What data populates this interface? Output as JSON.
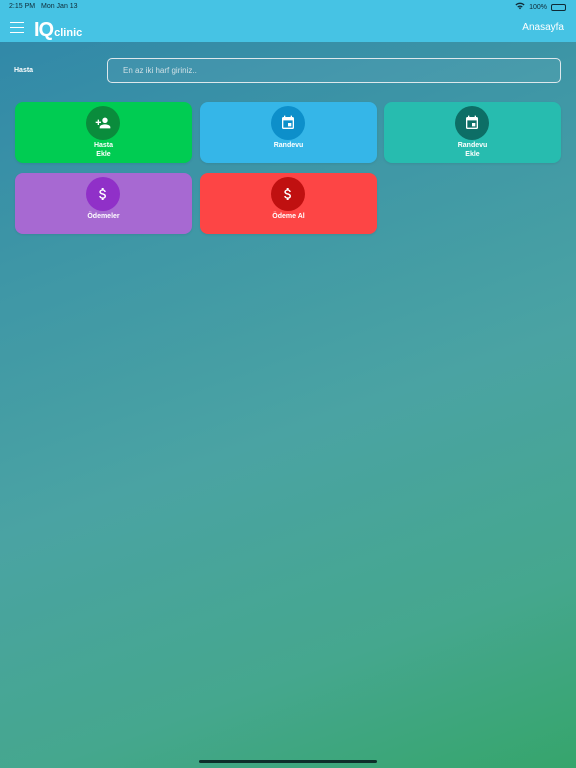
{
  "status_bar": {
    "time": "2:15 PM",
    "date": "Mon Jan 13",
    "battery": "100%",
    "battery_level": 1.0
  },
  "navbar": {
    "logo_iq": "IQ",
    "logo_text": "clinic",
    "title": "Anasayfa"
  },
  "search": {
    "label": "Hasta",
    "placeholder": "En az iki harf giriniz.."
  },
  "tiles": [
    {
      "label_line1": "Hasta",
      "label_line2": "Ekle",
      "icon": "add-user-icon",
      "color": "#00cc52",
      "icon_bg": "#0a8c3c"
    },
    {
      "label_line1": "Randevu",
      "label_line2": "",
      "icon": "calendar-icon",
      "color": "#35b6e8",
      "icon_bg": "#0d8fca"
    },
    {
      "label_line1": "Randevu",
      "label_line2": "Ekle",
      "icon": "calendar-icon",
      "color": "#27bcaf",
      "icon_bg": "#0d6e66"
    },
    {
      "label_line1": "Ödemeler",
      "label_line2": "",
      "icon": "dollar-icon",
      "color": "#a769d2",
      "icon_bg": "#9030c8"
    },
    {
      "label_line1": "Ödeme Al",
      "label_line2": "",
      "icon": "dollar-icon",
      "color": "#fd4545",
      "icon_bg": "#c01010"
    }
  ]
}
